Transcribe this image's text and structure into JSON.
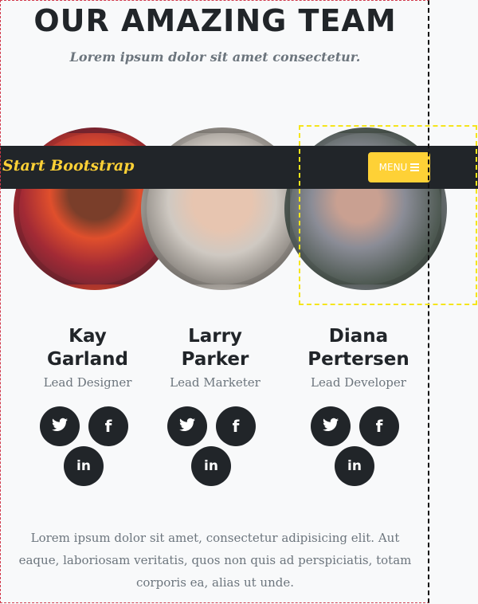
{
  "section": {
    "title": "OUR AMAZING TEAM",
    "subtitle": "Lorem ipsum dolor sit amet consectetur."
  },
  "navbar": {
    "brand": "Start Bootstrap",
    "menu_label": "MENU"
  },
  "team": [
    {
      "name_line1": "Kay",
      "name_line2": "Garland",
      "role": "Lead Designer"
    },
    {
      "name_line1": "Larry",
      "name_line2": "Parker",
      "role": "Lead Marketer"
    },
    {
      "name_line1": "Diana",
      "name_line2": "Pertersen",
      "role": "Lead Developer"
    }
  ],
  "social": {
    "twitter_glyph": "🐦",
    "facebook_glyph": "f",
    "linkedin_glyph": "in"
  },
  "icons": [
    "twitter-icon",
    "facebook-icon",
    "linkedin-icon",
    "hamburger-icon"
  ],
  "colors": {
    "accent": "#fed136",
    "dark": "#212529",
    "muted": "#6c757d",
    "background": "#f8f9fa"
  },
  "footer": {
    "text": "Lorem ipsum dolor sit amet, consectetur adipisicing elit. Aut eaque, laboriosam veritatis, quos non quis ad perspiciatis, totam corporis ea, alias ut unde."
  }
}
